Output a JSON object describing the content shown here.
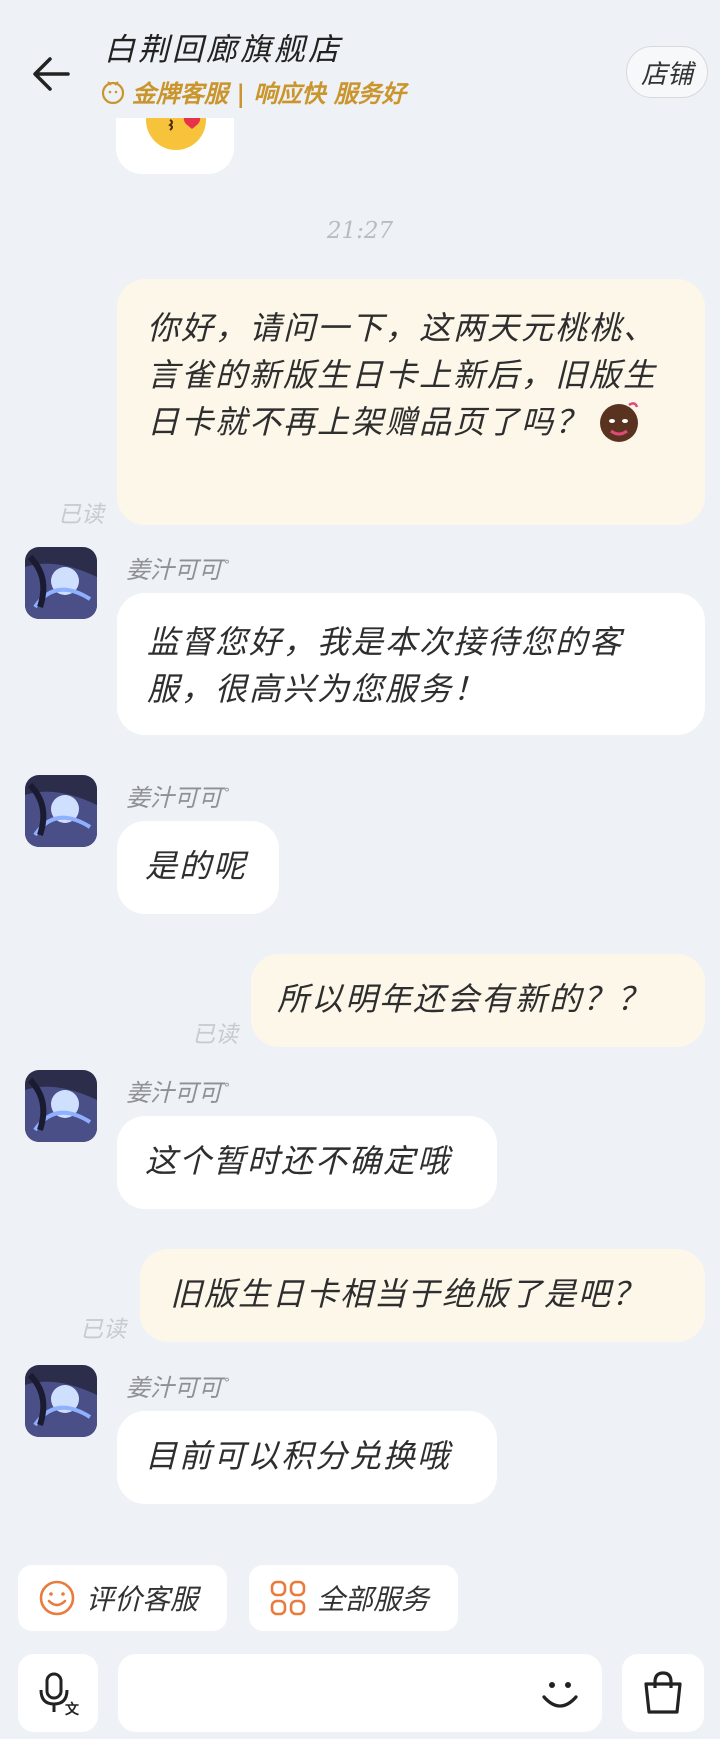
{
  "header": {
    "shop_name": "白荆回廊旗舰店",
    "badge": "金牌客服 | 响应快 服务好",
    "store_button": "店铺"
  },
  "timestamp": "21:27",
  "messages": [
    {
      "from": "me",
      "text": "你好，请问一下，这两天元桃桃、言雀的新版生日卡上新后，旧版生日卡就不再上架赠品页了吗？",
      "read": "已读"
    },
    {
      "from": "agent",
      "name": "姜汁可可",
      "text": "监督您好，我是本次接待您的客服，很高兴为您服务！"
    },
    {
      "from": "agent",
      "name": "姜汁可可",
      "text": "是的呢"
    },
    {
      "from": "me",
      "text": "所以明年还会有新的？？",
      "read": "已读"
    },
    {
      "from": "agent",
      "name": "姜汁可可",
      "text": "这个暂时还不确定哦"
    },
    {
      "from": "me",
      "text": "旧版生日卡相当于绝版了是吧？",
      "read": "已读"
    },
    {
      "from": "agent",
      "name": "姜汁可可",
      "text": "目前可以积分兑换哦"
    }
  ],
  "services": {
    "rate": "评价客服",
    "all": "全部服务"
  },
  "input": {
    "voice_icon": "microphone-icon",
    "emoji_icon": "smile-icon",
    "shop_icon": "shopping-bag-icon"
  },
  "colors": {
    "background": "#eef1f5",
    "outgoing_bubble": "#fdf7ea",
    "incoming_bubble": "#ffffff",
    "gold": "#c9952c",
    "orange_icon": "#e97b3c"
  }
}
